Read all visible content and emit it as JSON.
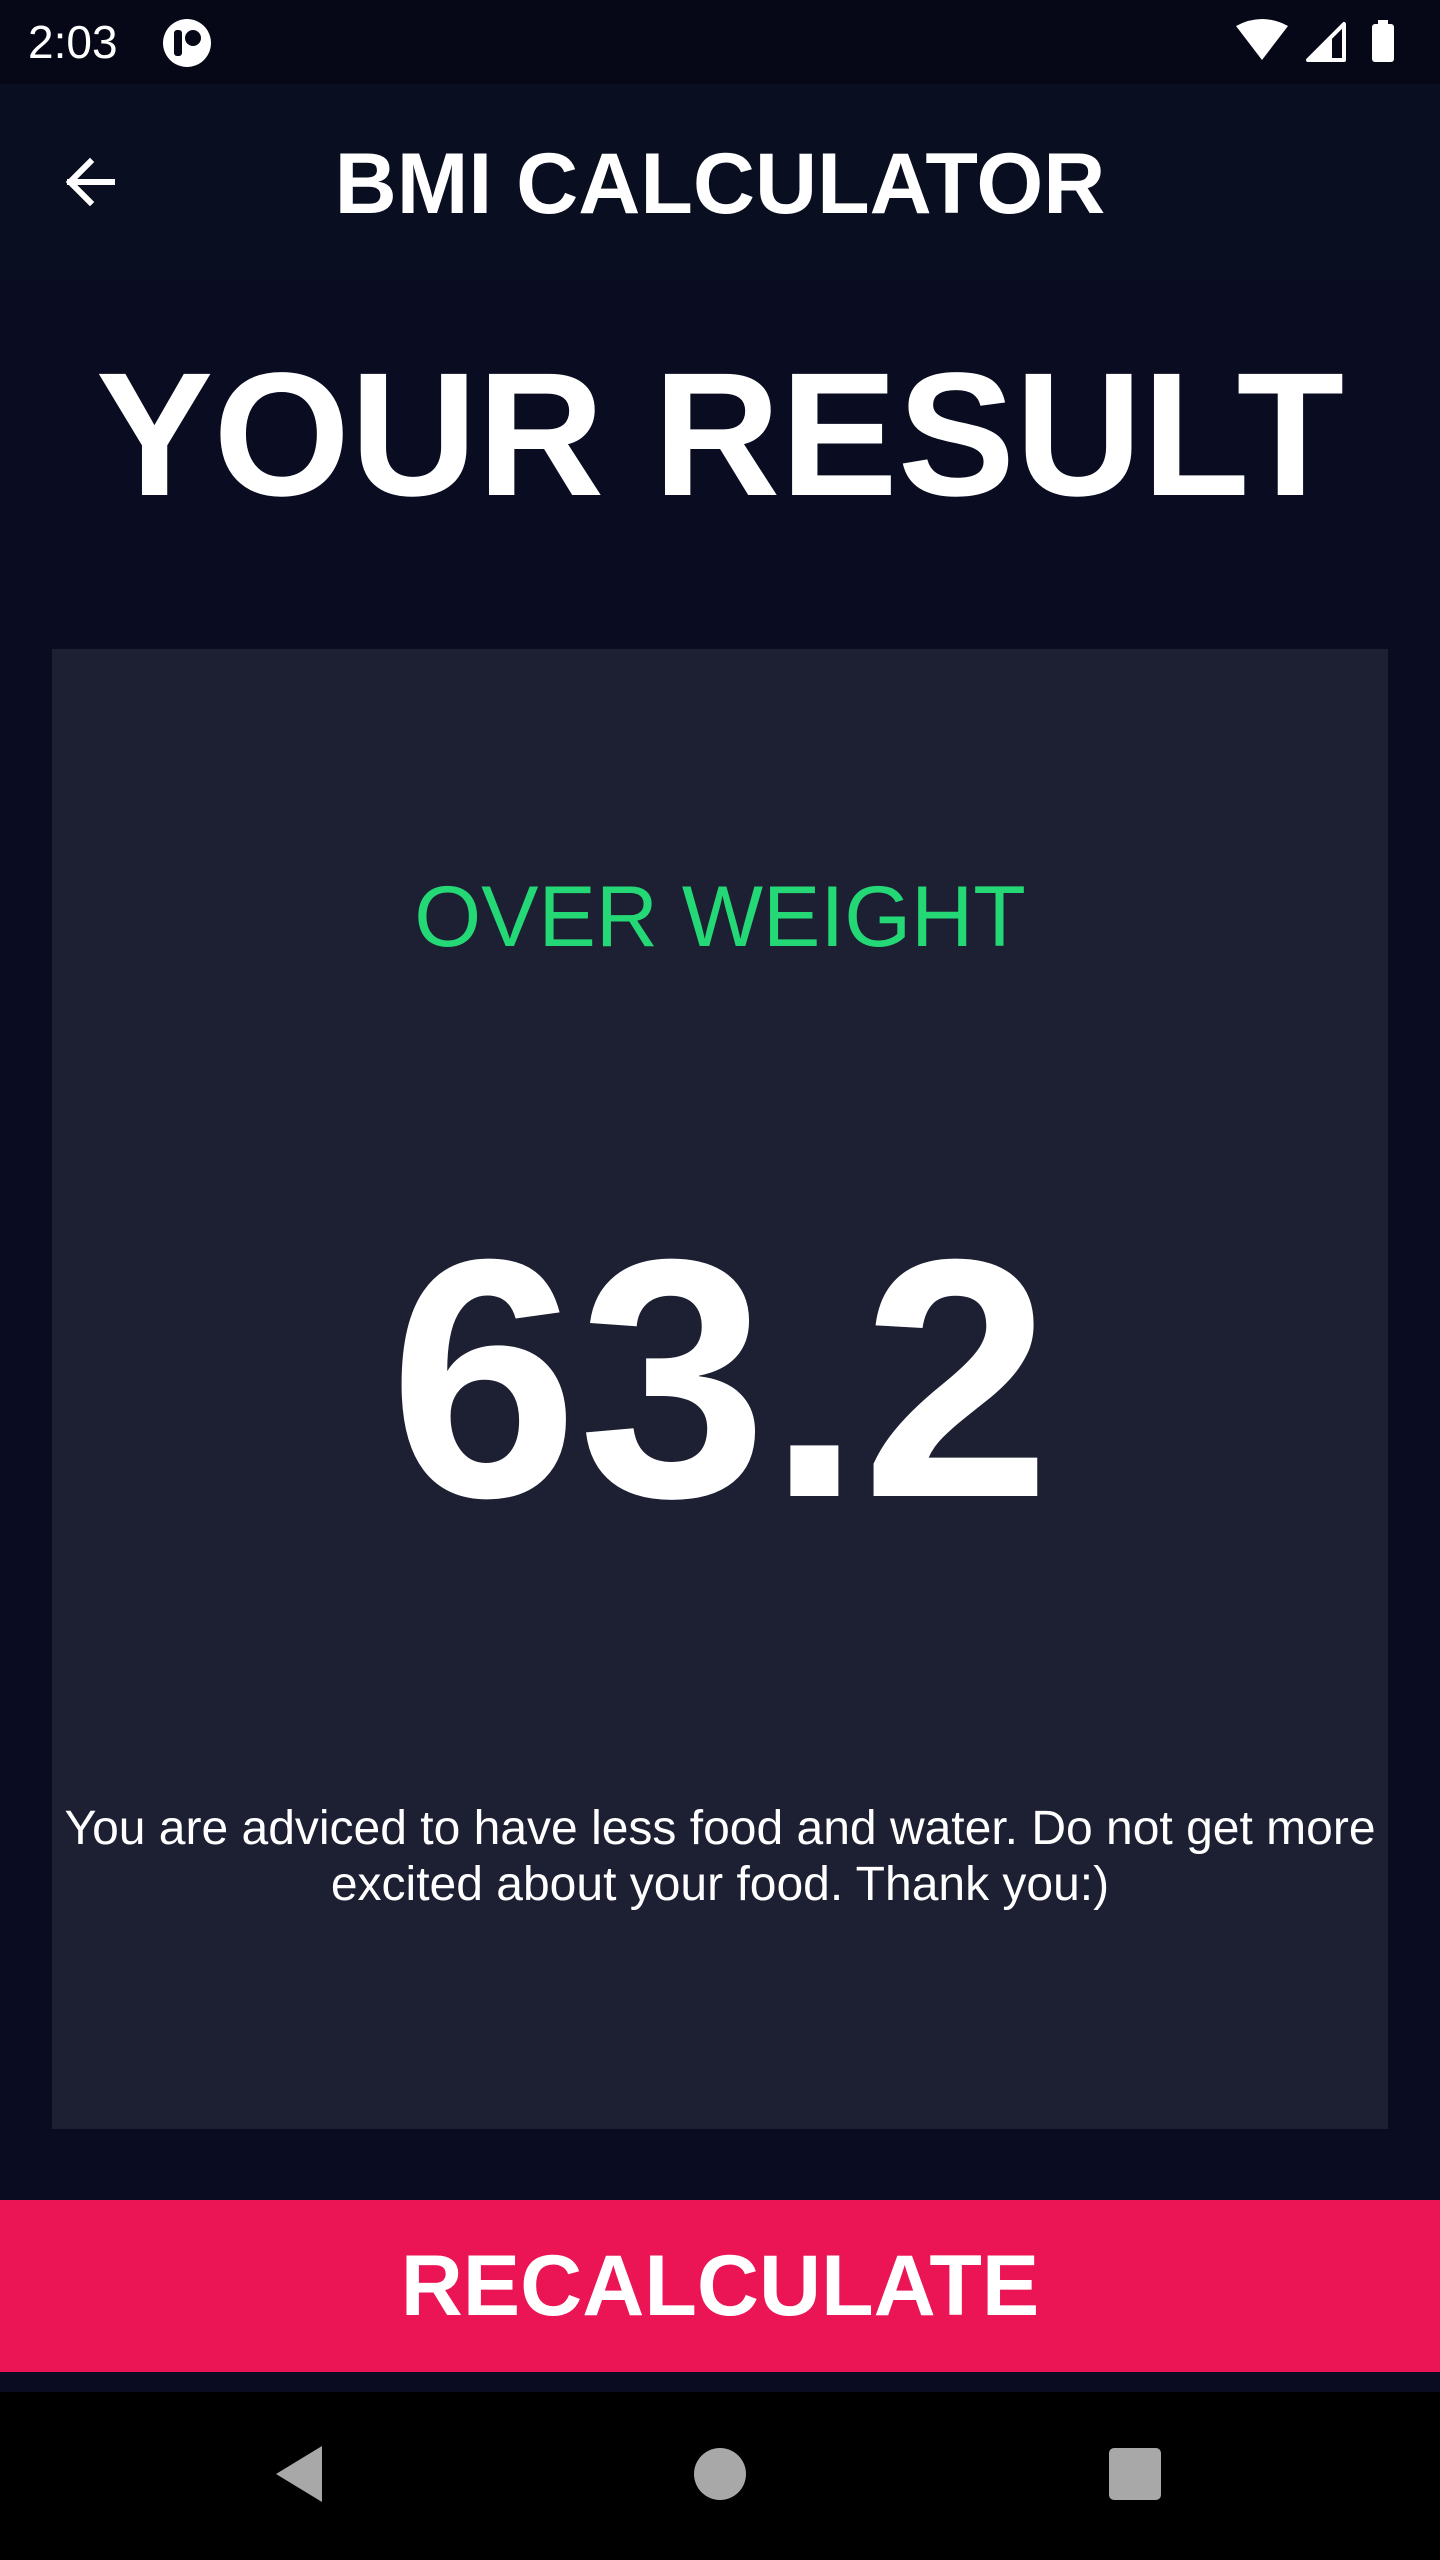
{
  "status_bar": {
    "time": "2:03",
    "icons": [
      "app-notification-icon",
      "wifi-icon",
      "cell-signal-icon",
      "battery-icon"
    ]
  },
  "app_bar": {
    "title": "BMI CALCULATOR",
    "back_icon": "arrow-back-icon"
  },
  "main": {
    "heading": "YOUR RESULT",
    "result_card": {
      "category": "OVER WEIGHT",
      "bmi": "63.2",
      "advice": "You are adviced to have less food and water. Do not get more excited about your food. Thank you:)"
    }
  },
  "bottom_button": {
    "label": "RECALCULATE"
  },
  "navigation": {
    "icons": [
      "nav-back-icon",
      "nav-home-icon",
      "nav-recents-icon"
    ]
  },
  "colors": {
    "background": "#0a0d22",
    "card": "#1d1f33",
    "accent": "#eb1555",
    "status_green": "#24d876",
    "text": "#ffffff"
  }
}
